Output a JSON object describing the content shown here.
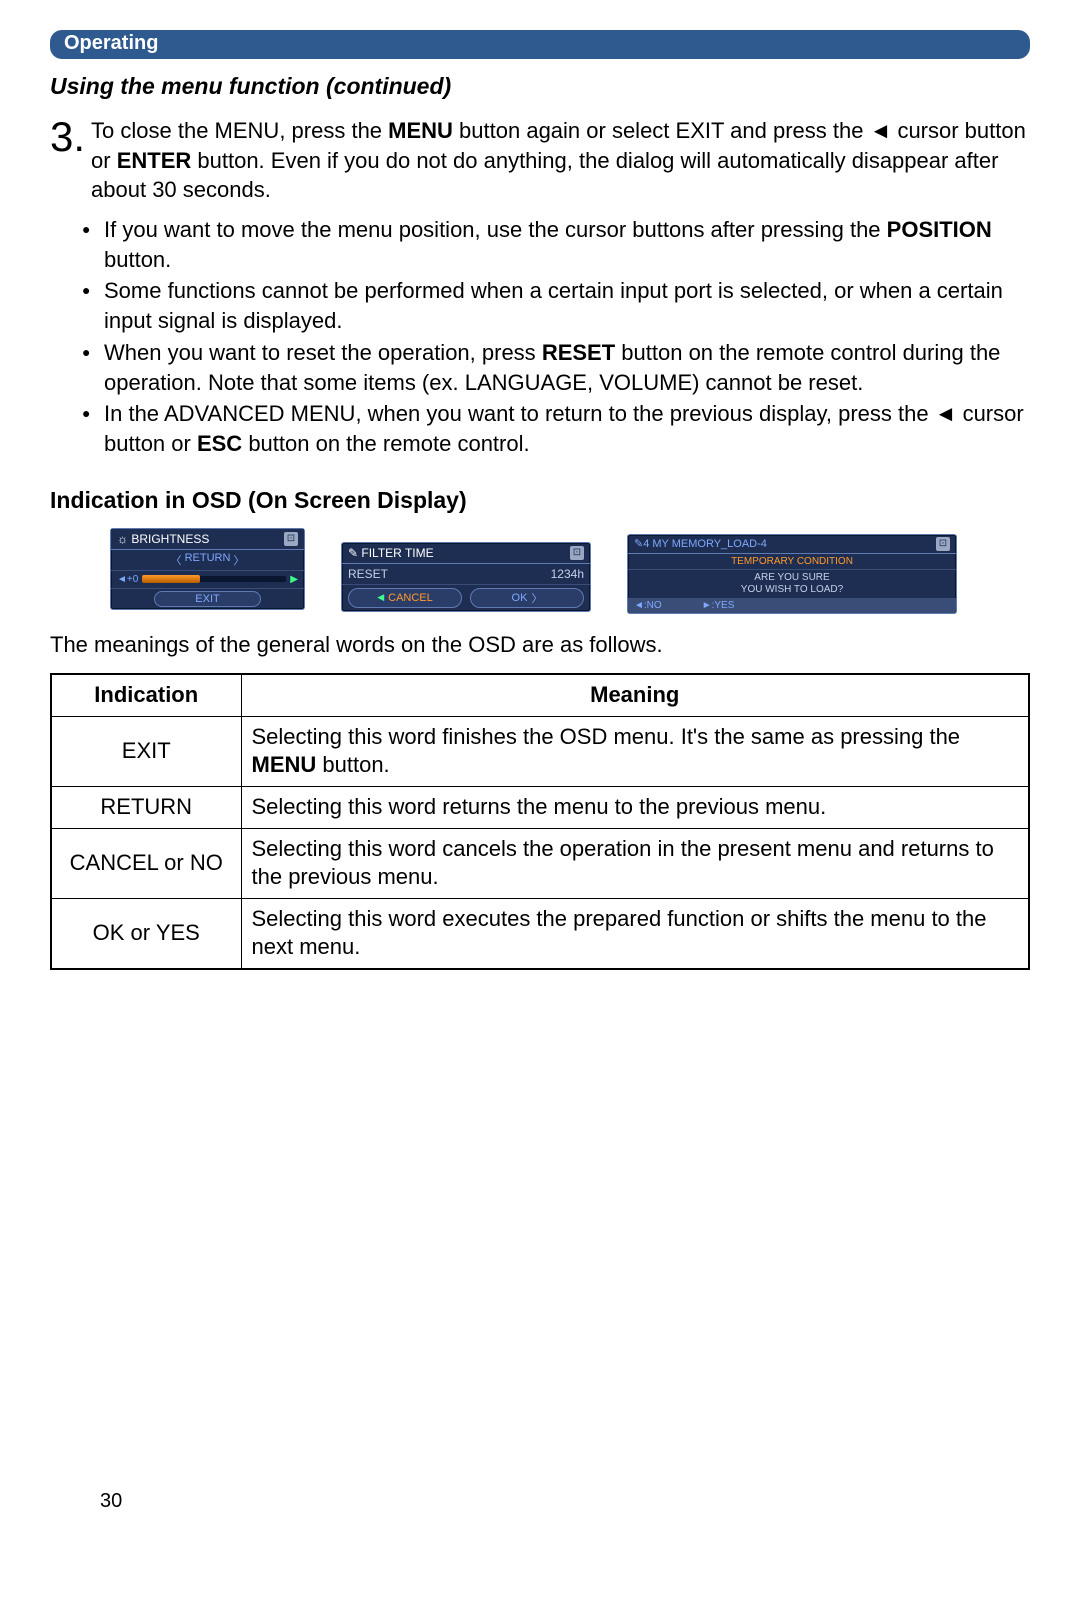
{
  "section_label": "Operating",
  "subtitle": "Using the menu function (continued)",
  "step": {
    "num": "3.",
    "text_parts": {
      "p1": "To close the MENU, press the ",
      "p2": "MENU",
      "p3": " button again or select EXIT and press the ◄ cursor button or ",
      "p4": "ENTER",
      "p5": " button. Even if you do not do anything, the dialog will automatically disappear after about 30 seconds."
    }
  },
  "bullets": [
    {
      "p1": "If you want to move the menu position, use the cursor buttons after pressing the ",
      "p2": "POSITION",
      "p3": " button."
    },
    {
      "p1": "Some functions cannot be performed when a certain input port is selected, or when a certain input signal is displayed.",
      "p2": "",
      "p3": ""
    },
    {
      "p1": "When you want to reset the operation, press ",
      "p2": "RESET",
      "p3": " button on the remote control during the operation. Note that some items (ex. LANGUAGE, VOLUME) cannot be reset."
    },
    {
      "p1": "In the ADVANCED MENU, when you want to return to the previous display, press the ◄ cursor button or ",
      "p2": "ESC",
      "p3": " button on the remote control."
    }
  ],
  "heading_osd": "Indication in OSD (On Screen Display)",
  "osd": {
    "brightness": {
      "title": "☼ BRIGHTNESS",
      "return": "RETURN",
      "value": "◄+0",
      "exit": "EXIT"
    },
    "filter": {
      "title": "✎ FILTER TIME",
      "reset": "RESET",
      "hours": "1234h",
      "cancel": "CANCEL",
      "ok": "OK"
    },
    "memory": {
      "title": "✎4 MY MEMORY_LOAD-4",
      "cond": "TEMPORARY CONDITION",
      "q1": "ARE YOU SURE",
      "q2": "YOU WISH TO LOAD?",
      "no": "◄:NO",
      "yes": "►:YES"
    }
  },
  "lead_text": "The meanings of the general words on the OSD are as follows.",
  "table": {
    "head_ind": "Indication",
    "head_mean": "Meaning",
    "rows": [
      {
        "ind": "EXIT",
        "mean_p1": "Selecting this word finishes the OSD menu. It's the same as pressing the ",
        "mean_b": "MENU",
        "mean_p2": " button."
      },
      {
        "ind": "RETURN",
        "mean_p1": "Selecting this word returns the menu to the previous menu.",
        "mean_b": "",
        "mean_p2": ""
      },
      {
        "ind": "CANCEL or NO",
        "mean_p1": "Selecting this word cancels the operation in the present menu and returns to the previous menu.",
        "mean_b": "",
        "mean_p2": ""
      },
      {
        "ind": "OK or YES",
        "mean_p1": "Selecting this word executes the prepared function or shifts the menu to the next menu.",
        "mean_b": "",
        "mean_p2": ""
      }
    ]
  },
  "page_number": "30"
}
